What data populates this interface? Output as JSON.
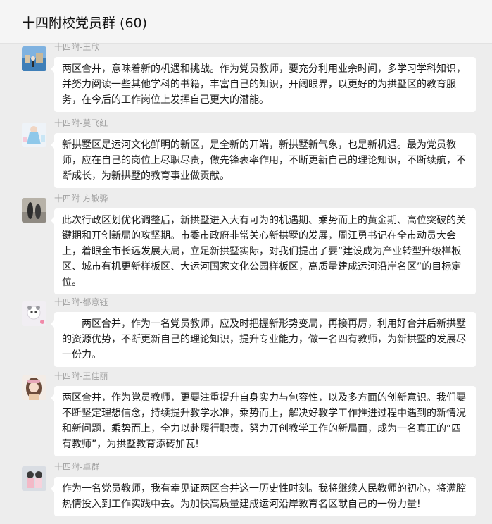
{
  "header": {
    "title": "十四附校党员群 (60)"
  },
  "messages": [
    {
      "sender": "十四附-王欣",
      "text": "两区合并，意味着新的机遇和挑战。作为党员教师，要充分利用业余时间，多学习学科知识，并努力阅读一些其他学科的书籍，丰富自己的知识，开阔眼界，以更好的为拱墅区的教育服务，在今后的工作岗位上发挥自己更大的潜能。"
    },
    {
      "sender": "十四附-莫飞红",
      "text": "新拱墅区是运河文化鲜明的新区，是全新的开端，新拱墅新气象，也是新机遇。最为党员教师，应在自己的岗位上尽职尽责，做先锋表率作用，不断更新自己的理论知识，不断续航，不断成长，为新拱墅的教育事业做贡献。"
    },
    {
      "sender": "十四附-方敏骅",
      "text": "此次行政区划优化调整后，新拱墅进入大有可为的机遇期、乘势而上的黄金期、高位突破的关键期和开创新局的攻坚期。市委市政府非常关心新拱墅的发展，周江勇书记在全市动员大会上，着眼全市长远发展大局，立足新拱墅实际，对我们提出了要“建设成为产业转型升级样板区、城市有机更新样板区、大运河国家文化公园样板区，高质量建成运河沿岸名区”的目标定位。"
    },
    {
      "sender": "十四附-都意钰",
      "text": "两区合并，作为一名党员教师，应及时把握新形势变局，再接再厉，利用好合并后新拱墅的资源优势，不断更新自己的理论知识，提升专业能力，做一名四有教师，为新拱墅的发展尽一份力。"
    },
    {
      "sender": "十四附-王佳丽",
      "text": "两区合并，作为党员教师，更要注重提升自身实力与包容性，以及多方面的创新意识。我们要不断坚定理想信念，持续提升教学水准，乘势而上，解决好教学工作推进过程中遇到的新情况和新问题，乘势而上，全力以赴履行职责，努力开创教学工作的新局面，成为一名真正的“四有教师”，为拱墅教育添砖加瓦!"
    },
    {
      "sender": "十四附-卓群",
      "text": "作为一名党员教师，我有幸见证两区合并这一历史性时刻。我将继续人民教师的初心，将满腔热情投入到工作实践中去。为加快高质量建成运河沿岸教育名区献自己的一份力量!"
    }
  ]
}
